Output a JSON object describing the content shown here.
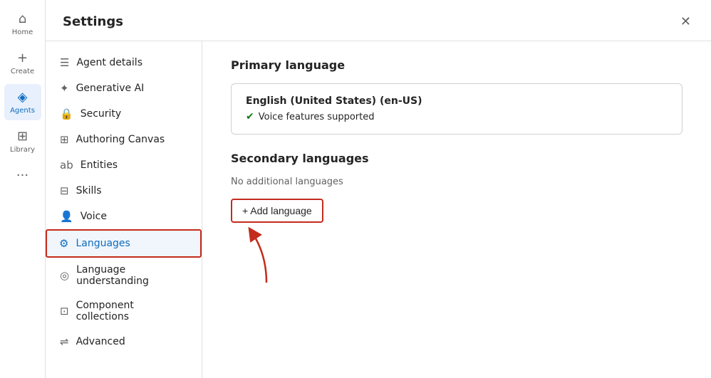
{
  "leftNav": {
    "items": [
      {
        "id": "home",
        "label": "Home",
        "icon": "⌂",
        "active": false
      },
      {
        "id": "create",
        "label": "Create",
        "icon": "+",
        "active": false
      },
      {
        "id": "agents",
        "label": "Agents",
        "icon": "◈",
        "active": true
      },
      {
        "id": "library",
        "label": "Library",
        "icon": "⊞",
        "active": false
      }
    ],
    "moreLabel": "···"
  },
  "settings": {
    "title": "Settings",
    "closeLabel": "✕",
    "sidebar": [
      {
        "id": "agent-details",
        "label": "Agent details",
        "icon": "☰",
        "active": false
      },
      {
        "id": "generative-ai",
        "label": "Generative AI",
        "icon": "✦",
        "active": false
      },
      {
        "id": "security",
        "label": "Security",
        "icon": "🔒",
        "active": false
      },
      {
        "id": "authoring-canvas",
        "label": "Authoring Canvas",
        "icon": "⊞",
        "active": false
      },
      {
        "id": "entities",
        "label": "Entities",
        "icon": "ab",
        "active": false
      },
      {
        "id": "skills",
        "label": "Skills",
        "icon": "⊟",
        "active": false
      },
      {
        "id": "voice",
        "label": "Voice",
        "icon": "👤",
        "active": false
      },
      {
        "id": "languages",
        "label": "Languages",
        "icon": "⚙",
        "active": true
      },
      {
        "id": "language-understanding",
        "label": "Language understanding",
        "icon": "◎",
        "active": false
      },
      {
        "id": "component-collections",
        "label": "Component collections",
        "icon": "⊡",
        "active": false
      },
      {
        "id": "advanced",
        "label": "Advanced",
        "icon": "⇌",
        "active": false
      }
    ],
    "content": {
      "primaryLanguageTitle": "Primary language",
      "primaryLanguageName": "English (United States) (en-US)",
      "voiceSupportText": "Voice features supported",
      "secondaryLanguagesTitle": "Secondary languages",
      "noAdditionalLanguages": "No additional languages",
      "addLanguageLabel": "+ Add language"
    }
  }
}
